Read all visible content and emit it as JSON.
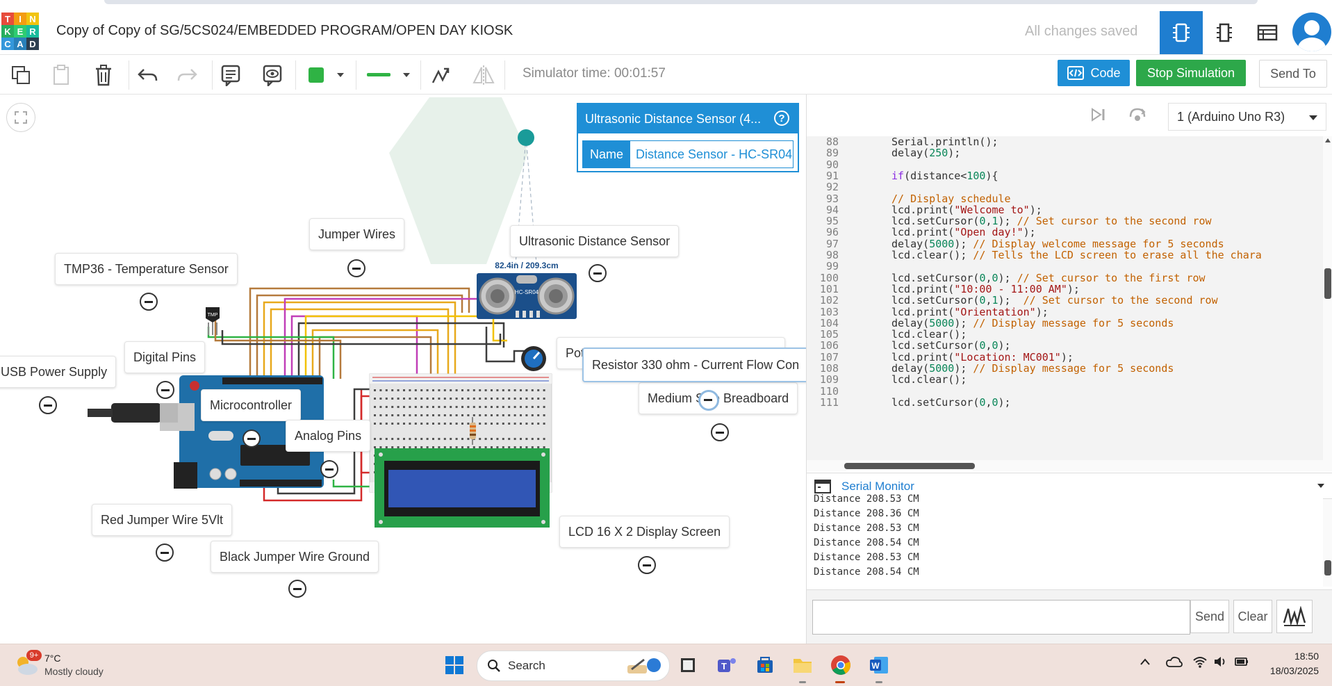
{
  "app": {
    "title": "Copy of Copy of SG/5CS024/EMBEDDED PROGRAM/OPEN DAY KIOSK",
    "save_status": "All changes saved",
    "logo_letters": [
      "T",
      "I",
      "N",
      "K",
      "E",
      "R",
      "C",
      "A",
      "D"
    ],
    "logo_colors": [
      "#e74c3c",
      "#f39c12",
      "#f1c40f",
      "#27ae60",
      "#2ecc71",
      "#1abc9c",
      "#3498db",
      "#2980b9",
      "#2c3e50"
    ]
  },
  "toolbar": {
    "simulator_time": "Simulator time: 00:01:57",
    "code_label": "Code",
    "stop_label": "Stop Simulation",
    "send_to_label": "Send To",
    "fill_color": "#2fb344",
    "line_color": "#2fb344"
  },
  "inspector": {
    "component_title": "Ultrasonic Distance Sensor (4...",
    "help": "?",
    "name_label": "Name",
    "name_value": "Distance Sensor - HC-SR04"
  },
  "canvas": {
    "sensor_reading": "82.4in / 209.3cm",
    "sensor_chip": "HC-SR04",
    "tmp_chip": "TMP",
    "annotations": {
      "jumper_wires": "Jumper Wires",
      "ultrasonic": "Ultrasonic Distance Sensor",
      "tmp36": "TMP36 - Temperature Sensor",
      "digital_pins": "Digital Pins",
      "usb_power": "USB Power Supply",
      "microcontroller": "Microcontroller",
      "analog_pins": "Analog Pins",
      "potentiometer": "Potentiometer - Contrast & Brightness",
      "breadboard": "Medium Size Breadboard",
      "resistor": "Resistor 330 ohm - Current Flow Con",
      "red_wire": "Red Jumper Wire 5Vlt",
      "black_wire": "Black Jumper Wire Ground",
      "lcd": "LCD 16 X 2 Display Screen"
    }
  },
  "code_panel": {
    "board": "1 (Arduino Uno R3)",
    "lines": [
      {
        "n": "88",
        "pre": "  Serial.println();",
        "html": "Serial.println();"
      },
      {
        "n": "89",
        "html": "delay(<span class=\"num\">250</span>);"
      },
      {
        "n": "90",
        "html": ""
      },
      {
        "n": "91",
        "html": "<span class=\"kw\">if</span>(distance&lt;<span class=\"num\">100</span>){"
      },
      {
        "n": "92",
        "html": ""
      },
      {
        "n": "93",
        "html": "<span class=\"cm\">// Display schedule</span>"
      },
      {
        "n": "94",
        "html": "lcd.print(<span class=\"str\">\"Welcome to\"</span>);"
      },
      {
        "n": "95",
        "html": "lcd.setCursor(<span class=\"num\">0</span>,<span class=\"num\">1</span>); <span class=\"cm\">// Set cursor to the second row</span>"
      },
      {
        "n": "96",
        "html": "lcd.print(<span class=\"str\">\"Open day!\"</span>);"
      },
      {
        "n": "97",
        "html": "delay(<span class=\"num\">5000</span>); <span class=\"cm\">// Display welcome message for 5 seconds</span>"
      },
      {
        "n": "98",
        "html": "lcd.clear(); <span class=\"cm\">// Tells the LCD screen to erase all the chara</span>"
      },
      {
        "n": "99",
        "html": ""
      },
      {
        "n": "100",
        "html": "lcd.setCursor(<span class=\"num\">0</span>,<span class=\"num\">0</span>); <span class=\"cm\">// Set cursor to the first row</span>"
      },
      {
        "n": "101",
        "html": "lcd.print(<span class=\"str\">\"10:00 - 11:00 AM\"</span>);"
      },
      {
        "n": "102",
        "html": "lcd.setCursor(<span class=\"num\">0</span>,<span class=\"num\">1</span>);  <span class=\"cm\">// Set cursor to the second row</span>"
      },
      {
        "n": "103",
        "html": "lcd.print(<span class=\"str\">\"Orientation\"</span>);"
      },
      {
        "n": "104",
        "html": "delay(<span class=\"num\">5000</span>); <span class=\"cm\">// Display message for 5 seconds</span>"
      },
      {
        "n": "105",
        "html": "lcd.clear();"
      },
      {
        "n": "106",
        "html": "lcd.setCursor(<span class=\"num\">0</span>,<span class=\"num\">0</span>);"
      },
      {
        "n": "107",
        "html": "lcd.print(<span class=\"str\">\"Location: MC001\"</span>);"
      },
      {
        "n": "108",
        "html": "delay(<span class=\"num\">5000</span>); <span class=\"cm\">// Display message for 5 seconds</span>"
      },
      {
        "n": "109",
        "html": "lcd.clear();"
      },
      {
        "n": "110",
        "html": ""
      },
      {
        "n": "111",
        "html": "lcd.setCursor(<span class=\"num\">0</span>,<span class=\"num\">0</span>);"
      }
    ]
  },
  "serial_monitor": {
    "title": "Serial Monitor",
    "lines": [
      "Distance 208.53 CM",
      "Distance 208.36 CM",
      "Distance 208.53 CM",
      "Distance 208.54 CM",
      "Distance 208.53 CM",
      "Distance 208.54 CM"
    ],
    "input_value": "",
    "send_label": "Send",
    "clear_label": "Clear"
  },
  "taskbar": {
    "weather_temp": "7°C",
    "weather_desc": "Mostly cloudy",
    "weather_badge": "9+",
    "search_placeholder": "Search",
    "time": "18:50",
    "date": "18/03/2025"
  }
}
